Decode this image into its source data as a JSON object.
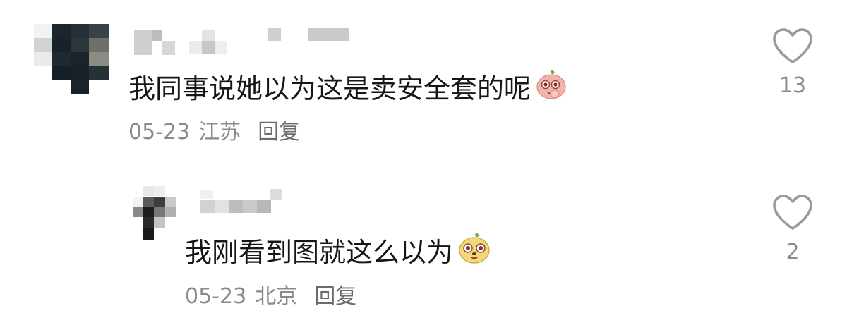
{
  "comments": [
    {
      "text": "我同事说她以为这是卖安全套的呢",
      "emoji": "peach-face-emoji",
      "date": "05-23",
      "location": "江苏",
      "reply_label": "回复",
      "likes": "13",
      "icon": "heart-outline-icon"
    },
    {
      "text": "我刚看到图就这么以为",
      "emoji": "yellow-face-emoji",
      "date": "05-23",
      "location": "北京",
      "reply_label": "回复",
      "likes": "2",
      "icon": "heart-outline-icon"
    }
  ],
  "colors": {
    "text": "#161616",
    "meta": "#8a8a8a",
    "heart_stroke": "#9a9a9a"
  }
}
